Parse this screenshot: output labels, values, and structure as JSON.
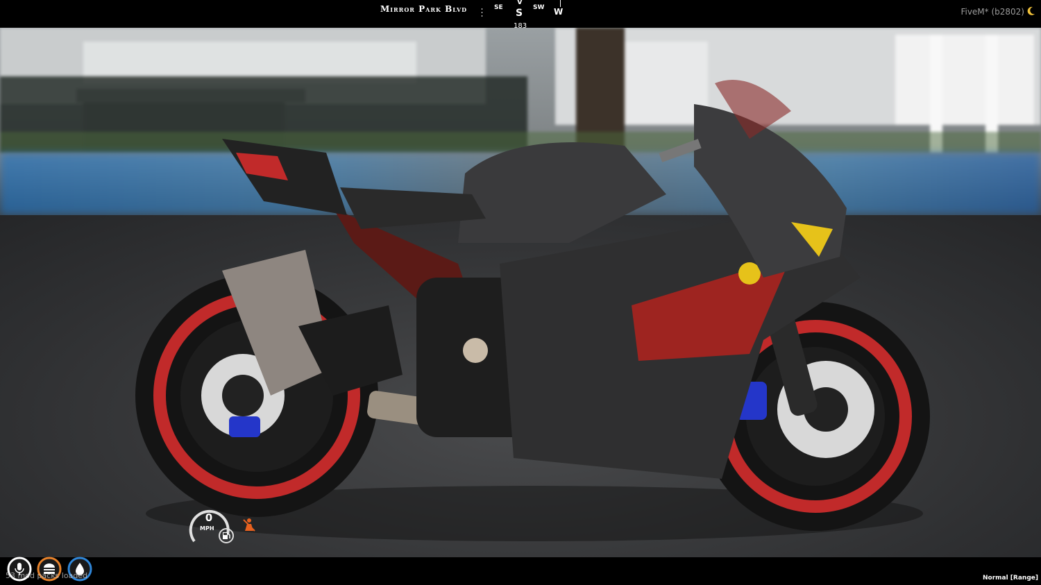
{
  "hud": {
    "street_name": "Mirror Park Blvd",
    "compass": {
      "left": "SE",
      "center_top": "V",
      "center": "S",
      "right": "SW",
      "far_right": "W"
    },
    "heading": "183",
    "server_label": "FiveM* (b2802)",
    "speed": {
      "value": "0",
      "unit": "MPH"
    },
    "status_text": "53 mod packs loaded",
    "mode_label": "Normal [Range]"
  },
  "colors": {
    "voice_ring": "#ffffff",
    "hunger_ring": "#e8822a",
    "thirst_ring": "#2f86d8",
    "seatbelt_warning": "#e8611f",
    "bike_wheel": "#c12a2a",
    "brake_caliper": "#2436c9"
  },
  "icons": [
    "moon-icon",
    "fuel-icon",
    "seatbelt-icon",
    "microphone-icon",
    "burger-icon",
    "water-drop-icon"
  ]
}
